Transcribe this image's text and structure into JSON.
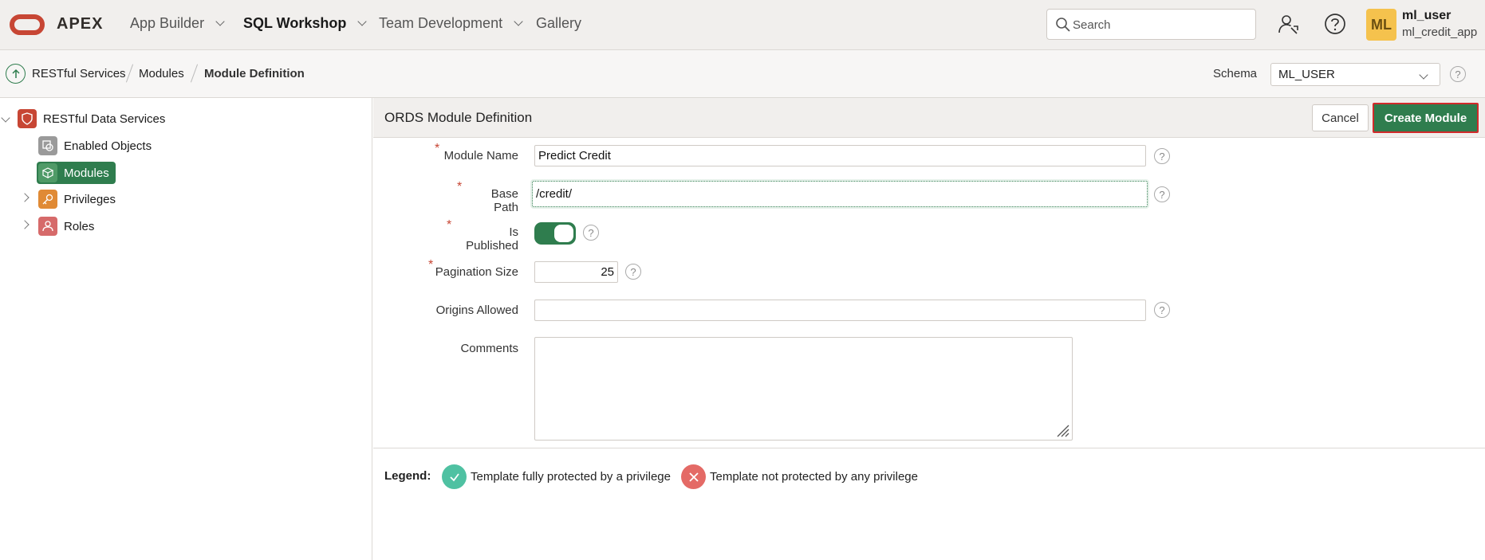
{
  "header": {
    "brand": "APEX",
    "nav": [
      {
        "label": "App Builder"
      },
      {
        "label": "SQL Workshop"
      },
      {
        "label": "Team Development"
      },
      {
        "label": "Gallery"
      }
    ],
    "search_placeholder": "Search",
    "avatar_initials": "ML",
    "user_name": "ml_user",
    "user_app": "ml_credit_app"
  },
  "breadcrumb": {
    "items": [
      "RESTful Services",
      "Modules",
      "Module Definition"
    ],
    "schema_label": "Schema",
    "schema_value": "ML_USER"
  },
  "tree": {
    "root": "RESTful Data Services",
    "children": [
      "Enabled Objects",
      "Modules",
      "Privileges",
      "Roles"
    ]
  },
  "panel": {
    "title": "ORDS Module Definition",
    "cancel_label": "Cancel",
    "create_label": "Create Module"
  },
  "form": {
    "module_name_label": "Module Name",
    "module_name_value": "Predict Credit",
    "base_path_label": "Base Path",
    "base_path_value": "/credit/",
    "is_published_label": "Is Published",
    "is_published": true,
    "pagination_label": "Pagination Size",
    "pagination_value": "25",
    "origins_label": "Origins Allowed",
    "origins_value": "",
    "comments_label": "Comments",
    "comments_value": ""
  },
  "legend": {
    "label": "Legend:",
    "protected": "Template fully protected by a privilege",
    "unprotected": "Template not protected by any privilege"
  },
  "colors": {
    "accent_green": "#2f7d4e",
    "oracle_red": "#c74634",
    "avatar_yellow": "#f5c24d"
  }
}
